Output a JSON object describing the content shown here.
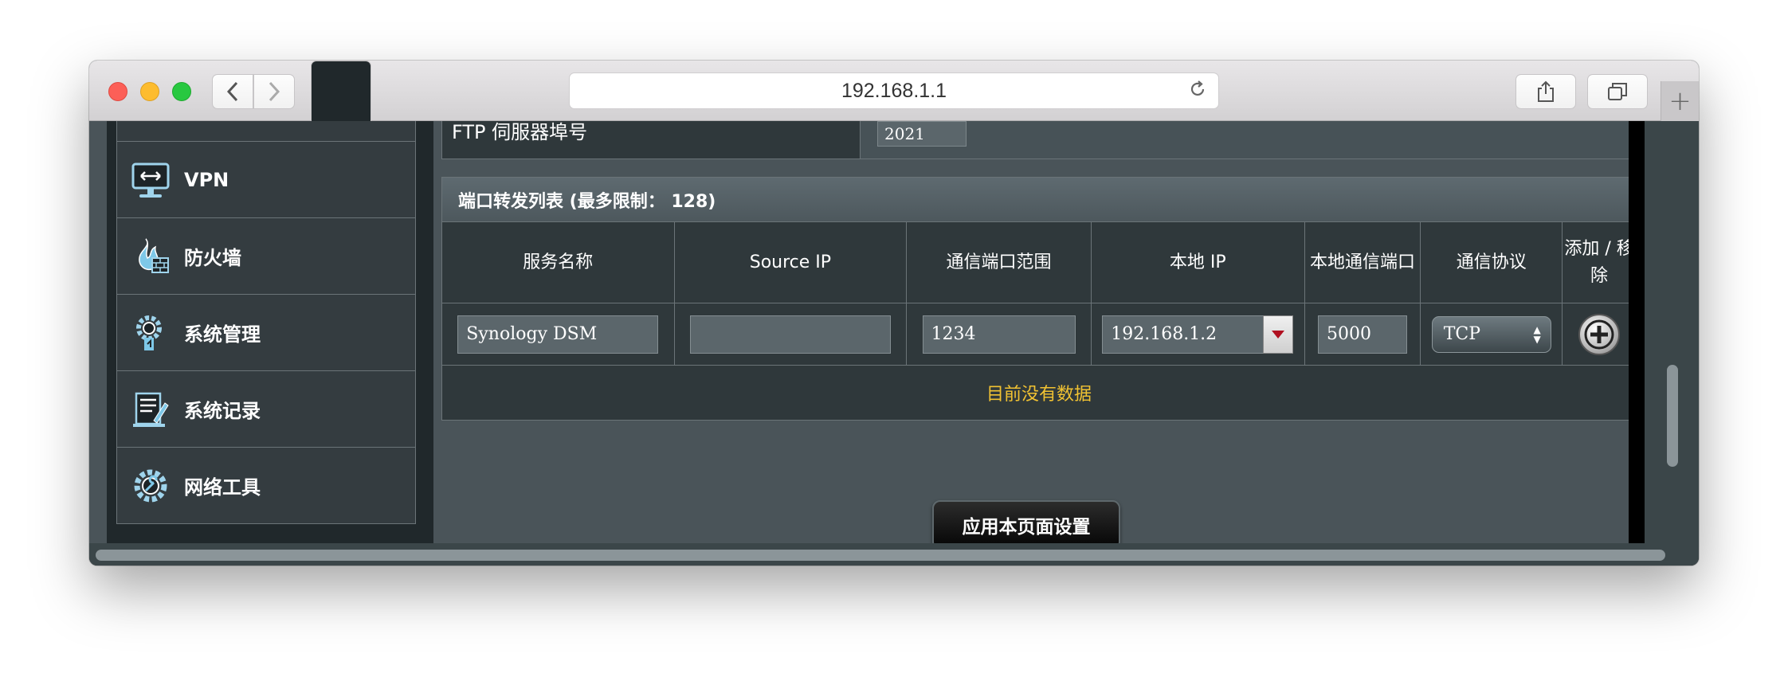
{
  "browser": {
    "url": "192.168.1.1"
  },
  "sidebar": {
    "items": [
      {
        "label": "VPN",
        "icon": "vpn-icon"
      },
      {
        "label": "防火墙",
        "icon": "firewall-icon"
      },
      {
        "label": "系统管理",
        "icon": "system-admin-icon"
      },
      {
        "label": "系统记录",
        "icon": "system-log-icon"
      },
      {
        "label": "网络工具",
        "icon": "network-tools-icon"
      }
    ]
  },
  "ftp": {
    "label": "FTP 伺服器埠号",
    "value": "2021"
  },
  "port_table": {
    "title": "端口转发列表 (最多限制： 128)",
    "headers": [
      "服务名称",
      "Source IP",
      "通信端口范围",
      "本地 IP",
      "本地通信端口",
      "通信协议",
      "添加 / 移除"
    ],
    "row": {
      "service_name": "Synology DSM",
      "source_ip": "",
      "port_range": "1234",
      "local_ip": "192.168.1.2",
      "local_port": "5000",
      "protocol": "TCP"
    },
    "empty_message": "目前没有数据"
  },
  "apply_label": "应用本页面设置",
  "colors": {
    "accent_text": "#f1c232",
    "panel": "#2f383b",
    "background": "#4a5459"
  }
}
